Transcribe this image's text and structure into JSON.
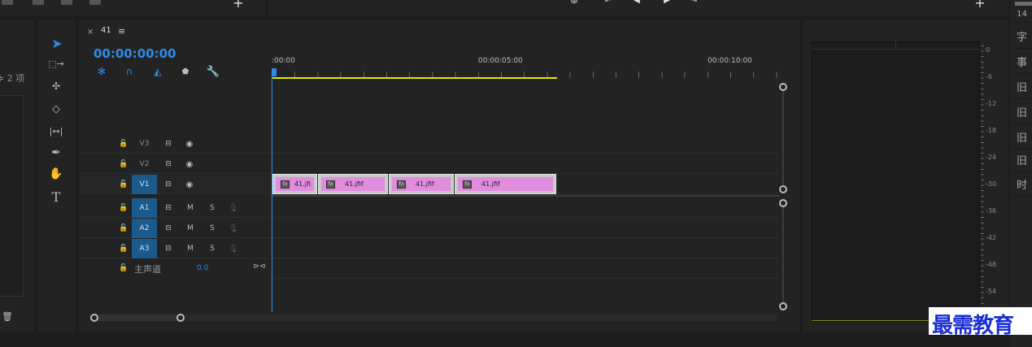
{
  "timeline": {
    "tab_label": "41",
    "timecode": "00:00:00:00",
    "ruler": {
      "labels": [
        ":00:00",
        "00:00:05:00",
        "00:00:10:00"
      ]
    },
    "video_tracks": [
      {
        "label": "V3",
        "target": false
      },
      {
        "label": "V2",
        "target": false
      },
      {
        "label": "V1",
        "target": true
      }
    ],
    "audio_tracks": [
      {
        "label": "A1",
        "m": "M",
        "s": "S"
      },
      {
        "label": "A2",
        "m": "M",
        "s": "S"
      },
      {
        "label": "A3",
        "m": "M",
        "s": "S"
      }
    ],
    "master": {
      "label": "主声道",
      "value": "0.0"
    },
    "clips": [
      {
        "name": "41.jfi"
      },
      {
        "name": "41.jfif"
      },
      {
        "name": "41.jfif"
      },
      {
        "name": "41.jfif"
      }
    ]
  },
  "project_panel": {
    "item_count": "≑ 2 项"
  },
  "audio_meter": {
    "scale": [
      "0",
      "-6",
      "-12",
      "-18",
      "-24",
      "-30",
      "-36",
      "-42",
      "-48",
      "-54"
    ]
  },
  "right_tabs": [
    "14",
    "字",
    "事",
    "旧",
    "旧",
    "旧",
    "旧",
    "时"
  ],
  "watermark": "最需教育",
  "colors": {
    "accent_blue": "#2d8ceb",
    "clip_pink": "#e08ddf",
    "work_area_yellow": "#e6e600",
    "watermark_blue": "#1a2fd6"
  }
}
